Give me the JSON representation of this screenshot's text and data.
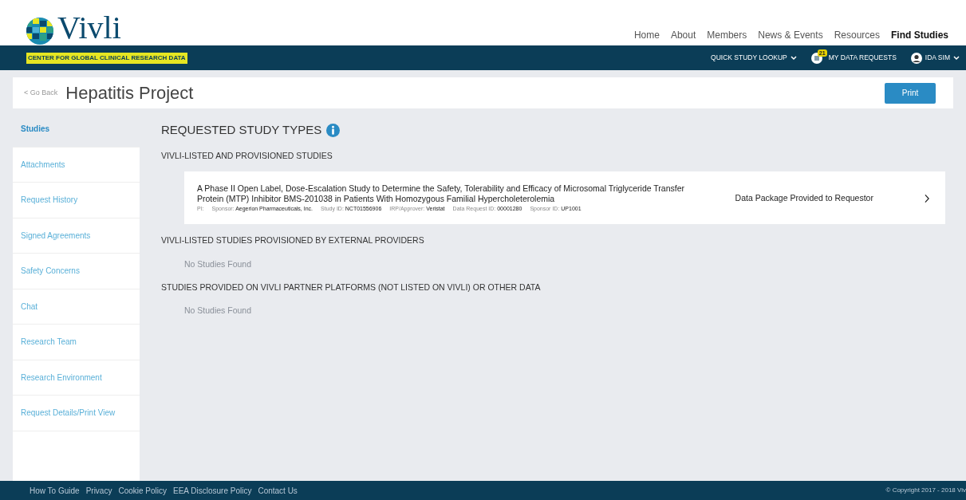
{
  "brand": {
    "name": "Vivli",
    "tagline": "CENTER FOR GLOBAL CLINICAL RESEARCH DATA"
  },
  "top_nav": [
    {
      "label": "Home",
      "selected": false
    },
    {
      "label": "About",
      "selected": false
    },
    {
      "label": "Members",
      "selected": false
    },
    {
      "label": "News & Events",
      "selected": false
    },
    {
      "label": "Resources",
      "selected": false
    },
    {
      "label": "Find Studies",
      "selected": true
    }
  ],
  "sub_nav": {
    "quick_lookup": "QUICK STUDY LOOKUP",
    "requests_badge": "21",
    "requests": "MY DATA REQUESTS",
    "user": "IDA SIM"
  },
  "page": {
    "back": "< Go Back",
    "title": "Hepatitis Project",
    "print": "Print"
  },
  "sidebar": [
    {
      "label": "Studies",
      "selected": true
    },
    {
      "label": "Attachments",
      "selected": false
    },
    {
      "label": "Request History",
      "selected": false
    },
    {
      "label": "Signed Agreements",
      "selected": false
    },
    {
      "label": "Safety Concerns",
      "selected": false
    },
    {
      "label": "Chat",
      "selected": false
    },
    {
      "label": "Research Team",
      "selected": false
    },
    {
      "label": "Research Environment",
      "selected": false
    },
    {
      "label": "Request Details/Print View",
      "selected": false
    }
  ],
  "heading": "REQUESTED STUDY TYPES",
  "sections": [
    {
      "title": "VIVLI-LISTED AND PROVISIONED STUDIES",
      "studies": [
        {
          "title": "A Phase II Open Label, Dose-Escalation Study to Determine the Safety, Tolerability and Efficacy of Microsomal Triglyceride Transfer Protein (MTP) Inhibitor BMS-201038 in Patients With Homozygous Familial Hypercholeterolemia",
          "meta": [
            {
              "label": "PI:"
            },
            {
              "label": "Sponsor:",
              "value": "Aegerion Pharmaceuticals, Inc."
            },
            {
              "label": "Study ID:",
              "value": "NCT01556906"
            },
            {
              "label": "IRP/Approver:",
              "value": "Veristat"
            },
            {
              "label": "Data Request ID:",
              "value": "00001280"
            },
            {
              "label": "Sponsor ID:",
              "value": "UP1001"
            }
          ],
          "status": "Data Package Provided to Requestor"
        }
      ]
    },
    {
      "title": "VIVLI-LISTED STUDIES PROVISIONED BY EXTERNAL PROVIDERS",
      "empty": "No Studies Found"
    },
    {
      "title": "STUDIES PROVIDED ON VIVLI PARTNER PLATFORMS (NOT LISTED ON VIVLI) OR OTHER DATA",
      "empty": "No Studies Found"
    }
  ],
  "footer": {
    "links": [
      "How To Guide",
      "Privacy",
      "Cookie Policy",
      "EEA Disclosure Policy",
      "Contact Us"
    ],
    "copyright": "© Copyright 2017 - 2018 Viv"
  }
}
